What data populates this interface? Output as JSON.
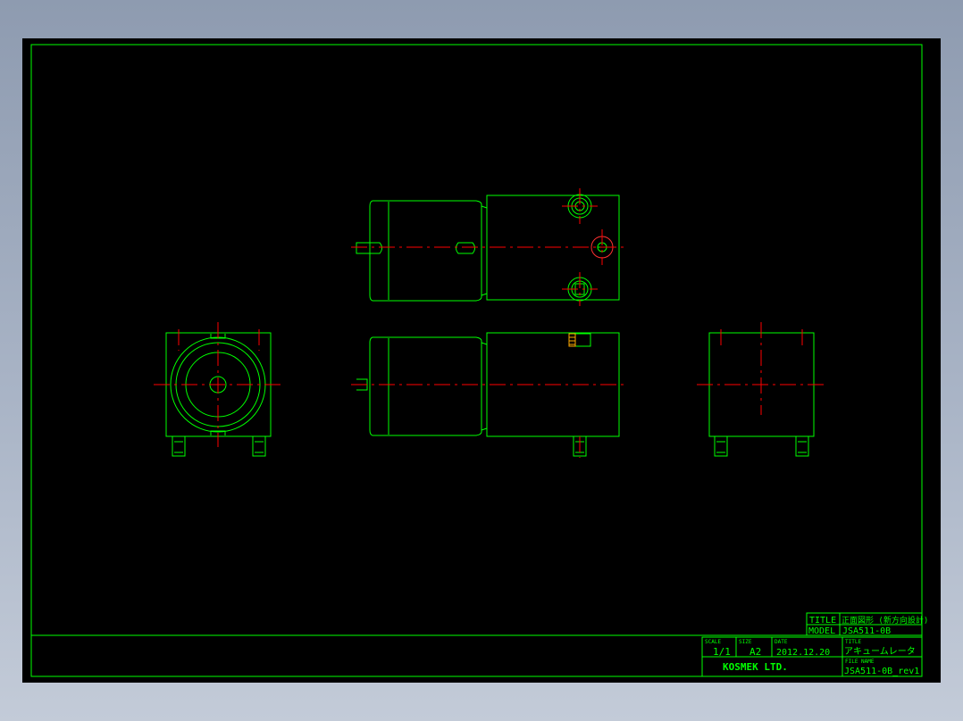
{
  "drawing": {
    "colors": {
      "background": "#000000",
      "outline": "#00ff00",
      "centerline": "#ff0000",
      "frame": "#00ff00"
    }
  },
  "title_block": {
    "title_label": "TITLE",
    "title_value": "正面図形 (新方向設計)",
    "model_label": "MODEL",
    "model_value": "JSA511-0B",
    "scale_label": "SCALE",
    "scale_value": "1/1",
    "size_label": "SIZE",
    "size_value": "A2",
    "date_label": "DATE",
    "date_value": "2012.12.20",
    "name_label": "TITLE",
    "name_value": "アキュームレータ",
    "file_label": "FILE NAME",
    "file_value": "JSA511-0B_rev1",
    "company": "KOSMEK LTD."
  }
}
